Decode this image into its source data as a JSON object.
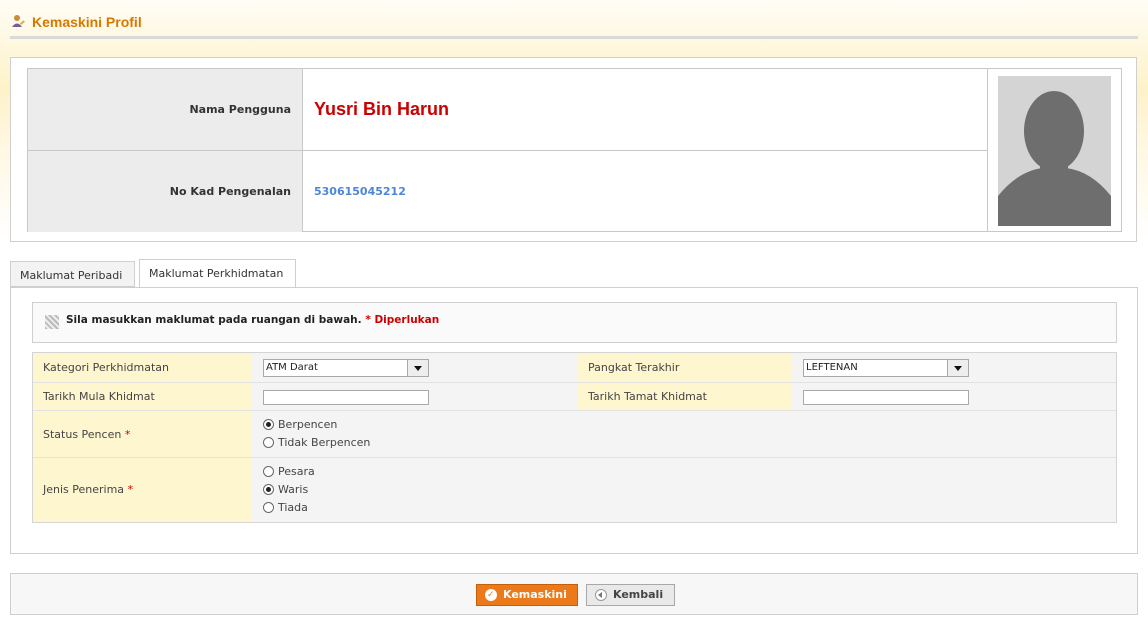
{
  "header": {
    "title": "Kemaskini Profil",
    "icon": "user-edit-icon"
  },
  "profile": {
    "name_label": "Nama Pengguna",
    "name_value": "Yusri Bin Harun",
    "ic_label": "No Kad Pengenalan",
    "ic_value": "530615045212",
    "photo": "avatar-placeholder-icon"
  },
  "tabs": [
    {
      "label": "Maklumat Peribadi",
      "active": false
    },
    {
      "label": "Maklumat Perkhidmatan",
      "active": true
    }
  ],
  "notice": {
    "text": "Sila masukkan maklumat pada ruangan di bawah.",
    "required_text": "* Diperlukan"
  },
  "form": {
    "kategori_label": "Kategori Perkhidmatan",
    "kategori_value": "ATM Darat",
    "pangkat_label": "Pangkat Terakhir",
    "pangkat_value": "LEFTENAN",
    "tarikh_mula_label": "Tarikh Mula Khidmat",
    "tarikh_mula_value": "",
    "tarikh_tamat_label": "Tarikh Tamat Khidmat",
    "tarikh_tamat_value": "",
    "status_label": "Status Pencen",
    "status_options": [
      {
        "label": "Berpencen",
        "checked": true
      },
      {
        "label": "Tidak Berpencen",
        "checked": false
      }
    ],
    "jenis_label": "Jenis Penerima",
    "jenis_options": [
      {
        "label": "Pesara",
        "checked": false
      },
      {
        "label": "Waris",
        "checked": true
      },
      {
        "label": "Tiada",
        "checked": false
      }
    ],
    "required_mark": "*"
  },
  "actions": {
    "update_label": "Kemaskini",
    "back_label": "Kembali"
  },
  "colors": {
    "accent": "#ec7a1a",
    "title": "#d77800",
    "name": "#cc0000",
    "ic": "#4d86d8",
    "label_bg": "#fdf6cf"
  }
}
